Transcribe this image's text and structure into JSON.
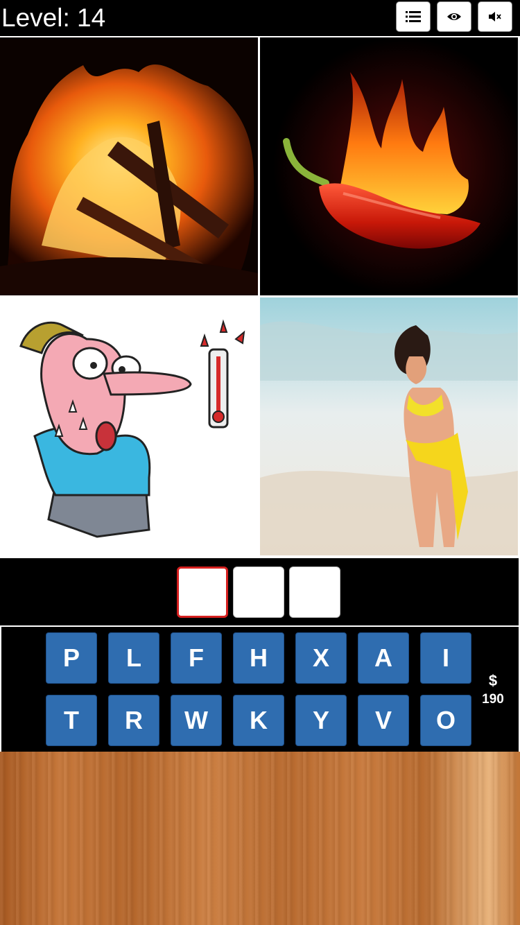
{
  "header": {
    "level_text": "Level: 14",
    "buttons": [
      {
        "icon": "list-icon"
      },
      {
        "icon": "eye-icon"
      },
      {
        "icon": "mute-icon"
      }
    ]
  },
  "pictures": [
    {
      "subject": "bonfire"
    },
    {
      "subject": "flaming-chili-pepper"
    },
    {
      "subject": "sweating-man-thermometer"
    },
    {
      "subject": "woman-on-beach"
    }
  ],
  "answer": {
    "slots": [
      "",
      "",
      ""
    ],
    "active_slot": 0
  },
  "keyboard": {
    "row1": [
      "P",
      "L",
      "F",
      "H",
      "X",
      "A",
      "I"
    ],
    "row2": [
      "T",
      "R",
      "W",
      "K",
      "Y",
      "V",
      "O"
    ]
  },
  "coins": {
    "symbol": "$",
    "amount": "190"
  },
  "colors": {
    "key_blue": "#2f6db0",
    "active_slot_border": "#d6201f"
  }
}
